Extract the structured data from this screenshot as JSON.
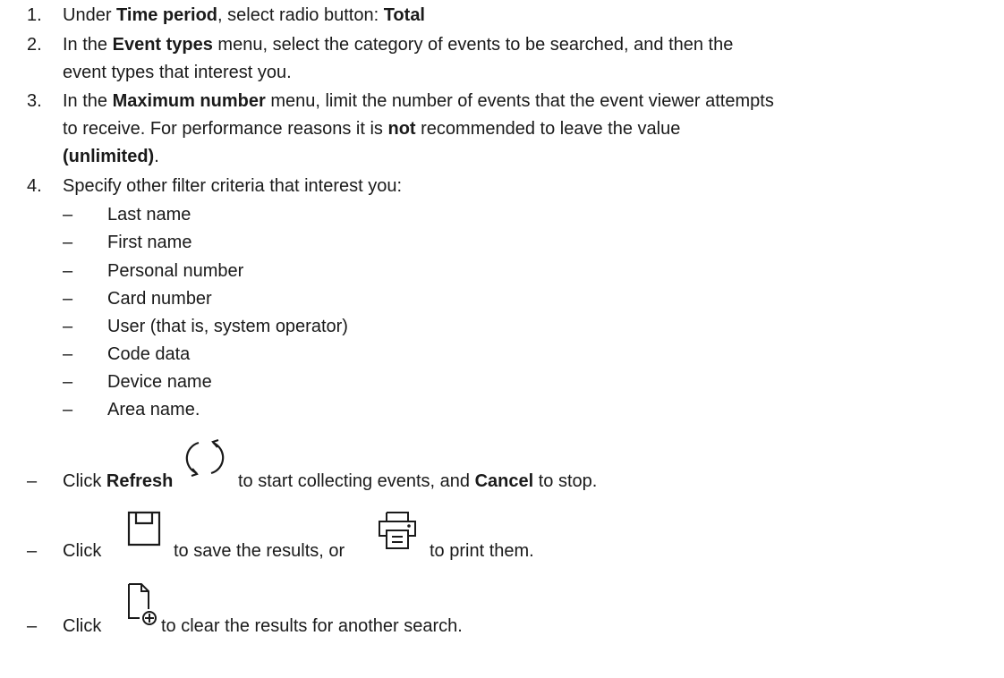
{
  "steps": [
    {
      "num": "1.",
      "t1": "Under ",
      "b1": "Time period",
      "t2": ", select radio button: ",
      "b2": "Total"
    },
    {
      "num": "2.",
      "t1": "In the ",
      "b1": "Event types",
      "t2": " menu, select the category of events to be searched, and then the",
      "line2": "event types that interest you."
    },
    {
      "num": "3.",
      "t1": "In the ",
      "b1": "Maximum number",
      "t2": " menu, limit the number of events that the event viewer attempts",
      "line2a": "to receive. For performance reasons it is ",
      "b2": "not",
      "line2b": " recommended to leave the value",
      "b3": "(unlimited)",
      "t3": "."
    },
    {
      "num": "4.",
      "text": "Specify other filter criteria that interest you:"
    }
  ],
  "criteria": [
    "Last name",
    "First name",
    "Personal number",
    "Card number",
    "User (that is, system operator)",
    "Code data",
    "Device name",
    "Area name."
  ],
  "dash": "–",
  "actions": {
    "refresh": {
      "t1": "Click ",
      "b1": "Refresh",
      "t2": " to start collecting events, and ",
      "b2": "Cancel",
      "t3": " to stop.",
      "icon": "refresh-icon"
    },
    "save_print": {
      "t1": "Click",
      "t2": "to save the results, or",
      "t3": "to print them.",
      "icon1": "save-icon",
      "icon2": "print-icon"
    },
    "clear": {
      "t1": "Click",
      "t2": "to clear the results for another search.",
      "icon": "new-search-icon"
    }
  }
}
